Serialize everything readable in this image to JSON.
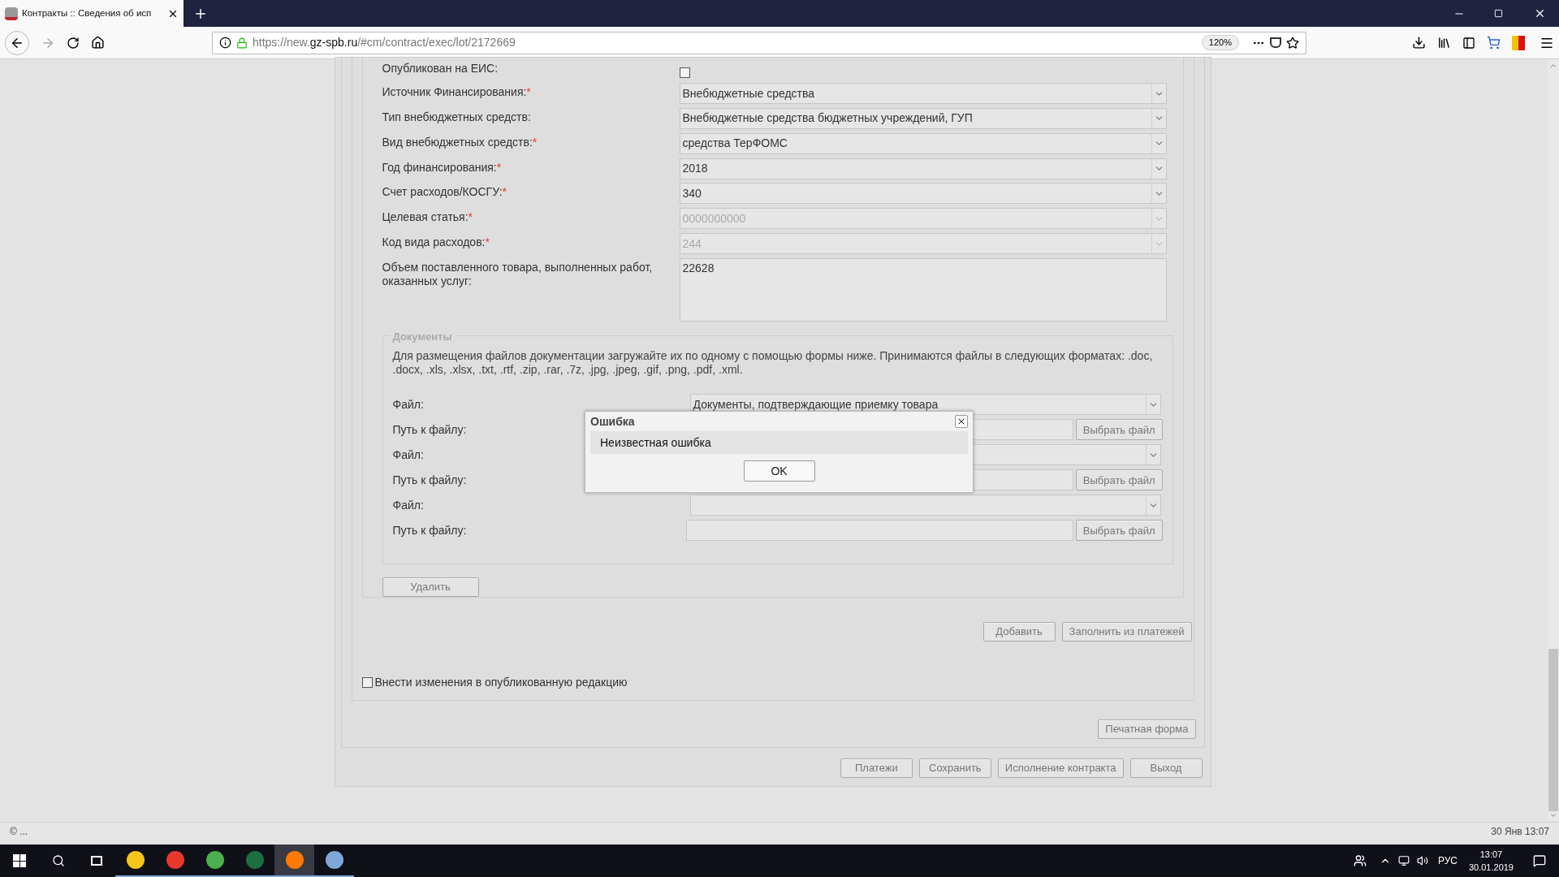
{
  "browser": {
    "tab_title": "Контракты :: Сведения об исп",
    "url_prefix": "https://new.",
    "url_domain": "gz-spb.ru",
    "url_path": "/#cm/contract/exec/lot/2172669",
    "zoom": "120%"
  },
  "form": {
    "rows": [
      {
        "kind": "checkbox",
        "label": "Опубликован на ЕИС:",
        "checked": false
      },
      {
        "kind": "select",
        "label": "Источник Финансирования:",
        "mark": "*",
        "value": "Внебюджетные средства",
        "disabled": false
      },
      {
        "kind": "select",
        "label": "Тип внебюджетных средств:",
        "value": "Внебюджетные средства бюджетных учреждений, ГУП",
        "disabled": false
      },
      {
        "kind": "select",
        "label": "Вид внебюджетных средств:",
        "mark": "*",
        "value": "средства ТерФОМС",
        "disabled": false
      },
      {
        "kind": "select",
        "label": "Год финансирования:",
        "mark": "*",
        "value": "2018",
        "disabled": false
      },
      {
        "kind": "select",
        "label": "Счет расходов/КОСГУ:",
        "mark": "*",
        "value": "340",
        "disabled": false
      },
      {
        "kind": "select",
        "label": "Целевая статья:",
        "mark": "*",
        "value": "0000000000",
        "disabled": true
      },
      {
        "kind": "select",
        "label": "Код вида расходов:",
        "mark": "*",
        "value": "244",
        "disabled": true
      },
      {
        "kind": "textarea",
        "label": "Объем поставленного товара, выполненных работ, оказанных услуг:",
        "value": "22628"
      }
    ]
  },
  "documents": {
    "legend": "Документы",
    "hint": "Для размещения файлов документации загружайте их по одному с помощью формы ниже. Принимаются файлы в следующих форматах: .doc, .docx, .xls, .xlsx, .txt, .rtf, .zip, .rar, .7z, .jpg, .jpeg, .gif, .png, .pdf, .xml.",
    "entries": [
      {
        "file_label": "Файл:",
        "file_value": "Документы, подтверждающие приемку товара",
        "path_label": "Путь к файлу:",
        "browse": "Выбрать файл"
      },
      {
        "file_label": "Файл:",
        "path_label": "Путь к файлу:",
        "browse": "Выбрать файл"
      },
      {
        "file_label": "Файл:",
        "path_label": "Путь к файлу:",
        "browse": "Выбрать файл"
      }
    ],
    "delete_button": "Удалить"
  },
  "actions": [
    "Добавить",
    "Заполнить из платежей"
  ],
  "publish_changes": {
    "label": "Внести изменения в опубликованную редакцию",
    "checked": false
  },
  "print_button": "Печатная форма",
  "footer_buttons": [
    "Платежи",
    "Сохранить",
    "Исполнение контракта",
    "Выход"
  ],
  "dialog": {
    "title": "Ошибка",
    "message": "Неизвестная ошибка",
    "ok": "OK"
  },
  "status_bar": {
    "left": "© ...",
    "right": "30 Янв 13:07"
  },
  "taskbar": {
    "language": "РУС",
    "time": "13:07",
    "date": "30.01.2019"
  }
}
